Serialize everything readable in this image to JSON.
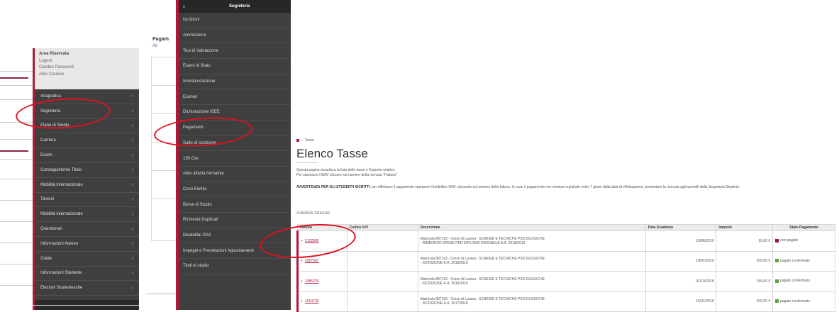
{
  "panel1": {
    "area": {
      "title": "Area Riservata",
      "items": [
        "Logout",
        "Cambia Password",
        "Altre Carriere"
      ]
    },
    "menu": [
      "Anagrafica",
      "Segreteria",
      "Piano di Studio",
      "Carriera",
      "Esami",
      "Conseguimento Titolo",
      "Mobilità internazionale",
      "Tirocini",
      "Mobilità internazionale",
      "Questionari",
      "Informazioni Ateneo",
      "Guide",
      "Informazioni Studente",
      "Elezioni Studentesche"
    ],
    "chevron": "›"
  },
  "panel2": {
    "background": {
      "title": "Pagam",
      "subtitle": "Ab"
    },
    "header": {
      "back": "‹",
      "title": "Segreteria"
    },
    "items": [
      "Iscrizioni",
      "Ammissione",
      "Test di Valutazione",
      "Esami di Stato",
      "Immatricolazione",
      "Esoneri",
      "Dichiarazione ISEE",
      "Pagamenti",
      "Salto di Iscrizione",
      "150 Ore",
      "Altre attività formative",
      "Corsi Elettivi",
      "Borse di Studio",
      "Richiesta Duplicati",
      "Disabilità/ DSA",
      "Impegni e Prenotazioni Appuntamenti",
      "Titoli di studio"
    ]
  },
  "panel3": {
    "breadcrumb": "Tasse",
    "title": "Elenco Tasse",
    "intro": [
      "Questa pagina visualizza la lista delle tasse e l'importo relativo.",
      "Per stampare il MAV cliccare sul numero della ricevuta \"Fattura\""
    ],
    "warning_bold": "AVVERTENZA PER GLI STUDENTI ISCRITTI",
    "warning_text": ": per effettuare il pagamento stampare il bollettino MAV cliccando sul numero della fattura. In caso il pagamento non venisse registrato entro 7 giorni dalla data di effettuazione, presentare la ricevuta agli sportelli della Segreteria Studenti.",
    "section": "Addebiti fatturati",
    "table": {
      "headers": [
        "Fattura",
        "Codice IUV",
        "Descrizione",
        "Data Scadenza",
        "Importo",
        "Stato Pagamento"
      ],
      "rows": [
        {
          "fattura": "2122865",
          "iuv": "",
          "desc1": "Matricola 887193 - Corso di Laurea - SCIENZE E TECNICHE PSICOLOGICHE",
          "desc2": "- RIMBORSO SPESE PER DIPLOMA ORIGINALE A.A. 2018/2019",
          "scadenza": "18/06/2019",
          "importo": "32,00 €",
          "stato": "non pagato",
          "stato_color": "red"
        },
        {
          "fattura": "2067687",
          "iuv": "",
          "desc1": "Matricola 887193 - Corso di Laurea - SCIENZE E TECNICHE PSICOLOGICHE",
          "desc2": "- ISCRIZIONE A.A. 2018/2019",
          "scadenza": "18/01/2019",
          "importo": "200,00 €",
          "stato": "pagato confermato",
          "stato_color": "green"
        },
        {
          "fattura": "1985220",
          "iuv": "",
          "desc1": "Matricola 887193 - Corso di Laurea - SCIENZE E TECNICHE PSICOLOGICHE",
          "desc2": "- ISCRIZIONE A.A. 2018/2019",
          "scadenza": "01/10/2018",
          "importo": "156,00 €",
          "stato": "pagato confermato",
          "stato_color": "green"
        },
        {
          "fattura": "1914730",
          "iuv": "",
          "desc1": "Matricola 887193 - Corso di Laurea - SCIENZE E TECNICHE PSICOLOGICHE",
          "desc2": "- ISCRIZIONE A.A. 2017/2018",
          "scadenza": "15/01/2018",
          "importo": "200,00 €",
          "stato": "pagato confermato",
          "stato_color": "green"
        }
      ]
    }
  },
  "annotation_color": "#e01020",
  "accent_color": "#b0183a"
}
